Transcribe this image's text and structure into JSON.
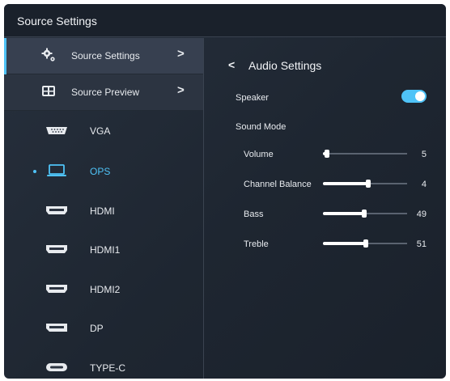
{
  "window": {
    "title": "Source Settings"
  },
  "menu": [
    {
      "label": "Source Settings",
      "icon": "gear-icon",
      "chevron": ">"
    },
    {
      "label": "Source Preview",
      "icon": "preview-icon",
      "chevron": ">"
    }
  ],
  "sources": [
    {
      "label": "VGA",
      "icon": "vga-port-icon"
    },
    {
      "label": "OPS",
      "icon": "laptop-icon"
    },
    {
      "label": "HDMI",
      "icon": "hdmi-port-icon"
    },
    {
      "label": "HDMI1",
      "icon": "hdmi-port-icon"
    },
    {
      "label": "HDMI2",
      "icon": "hdmi-port-icon"
    },
    {
      "label": "DP",
      "icon": "displayport-icon"
    },
    {
      "label": "TYPE-C",
      "icon": "usb-c-port-icon"
    }
  ],
  "selected_source": "OPS",
  "panel": {
    "back": "<",
    "title": "Audio Settings",
    "speaker_label": "Speaker",
    "speaker_on": true,
    "sound_mode_label": "Sound Mode",
    "sliders": [
      {
        "label": "Volume",
        "value": "5",
        "level": 0.05
      },
      {
        "label": "Channel Balance",
        "value": "4",
        "level": 0.54
      },
      {
        "label": "Bass",
        "value": "49",
        "level": 0.49
      },
      {
        "label": "Treble",
        "value": "51",
        "level": 0.51
      }
    ]
  },
  "colors": {
    "accent": "#4fc3f7",
    "background": "#1e2631",
    "panel": "#2c3441"
  }
}
